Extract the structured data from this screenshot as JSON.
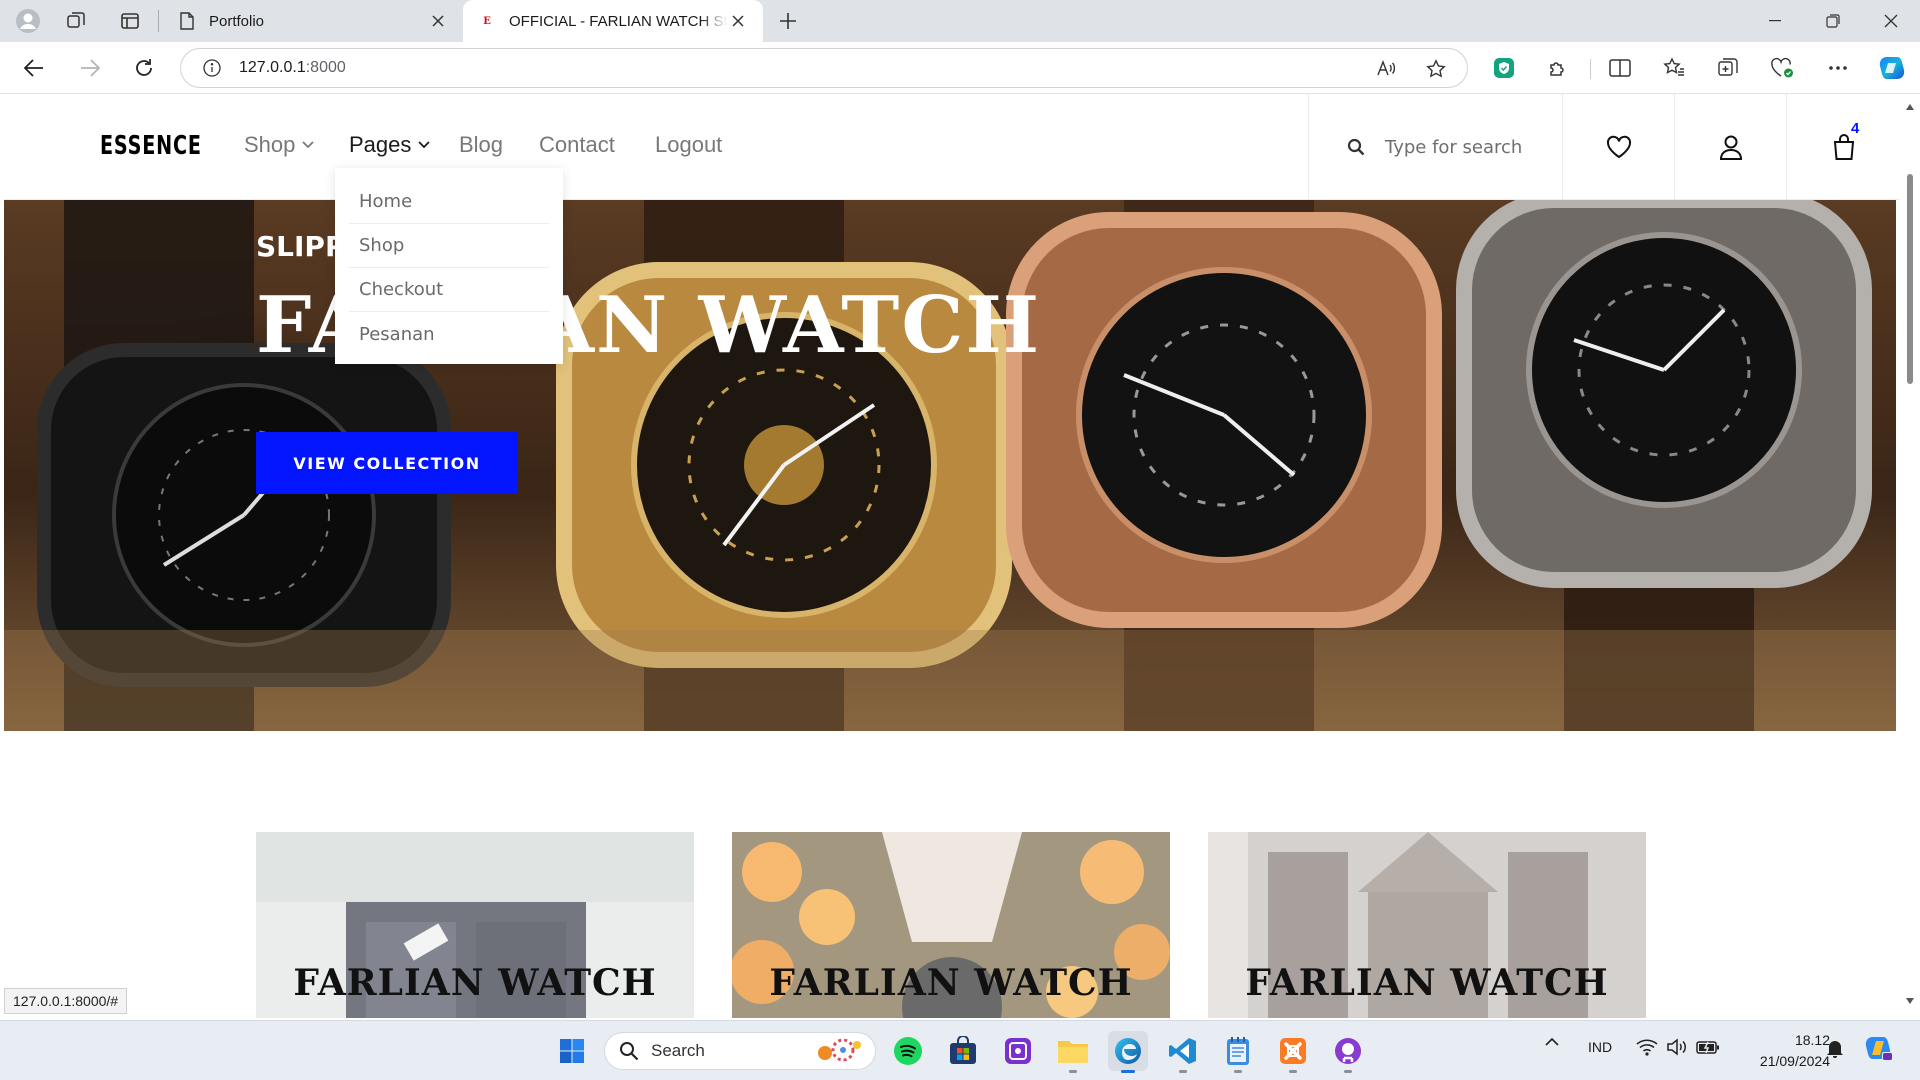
{
  "browser": {
    "tabs": [
      {
        "title": "Portfolio",
        "active": false
      },
      {
        "title": "OFFICIAL - FARLIAN WATCH Sto",
        "favicon_letter": "E",
        "active": true
      }
    ],
    "address": {
      "host": "127.0.0.1",
      "port": ":8000"
    },
    "status_url": "127.0.0.1:8000/#"
  },
  "site": {
    "logo": "ESSENCE",
    "nav": {
      "shop": "Shop",
      "pages": "Pages",
      "blog": "Blog",
      "contact": "Contact",
      "logout": "Logout"
    },
    "pages_dropdown": [
      "Home",
      "Shop",
      "Checkout",
      "Pesanan"
    ],
    "search_placeholder": "Type for search",
    "cart_count": "4",
    "hero": {
      "subtitle": "SLIPPERS",
      "title": "FARLIAN WATCH",
      "button": "VIEW COLLECTION"
    },
    "categories": [
      "FARLIAN WATCH",
      "FARLIAN WATCH",
      "FARLIAN WATCH"
    ],
    "accent_color": "#0315ff"
  },
  "taskbar": {
    "search_label": "Search",
    "language": "IND",
    "time": "18.12",
    "date": "21/09/2024"
  },
  "icons": [
    "profile-icon",
    "workspaces-icon",
    "tab-actions-icon",
    "page-icon",
    "close-icon",
    "new-tab-icon",
    "minimize-icon",
    "restore-icon",
    "back-icon",
    "forward-icon",
    "refresh-icon",
    "info-icon",
    "read-aloud-icon",
    "favorite-icon",
    "extensions-icon",
    "split-screen-icon",
    "collections-icon",
    "more-icon",
    "copilot-icon",
    "search-icon",
    "heart-icon",
    "user-icon",
    "bag-icon",
    "windows-icon",
    "wifi-icon",
    "volume-icon",
    "battery-icon",
    "bell-icon"
  ]
}
